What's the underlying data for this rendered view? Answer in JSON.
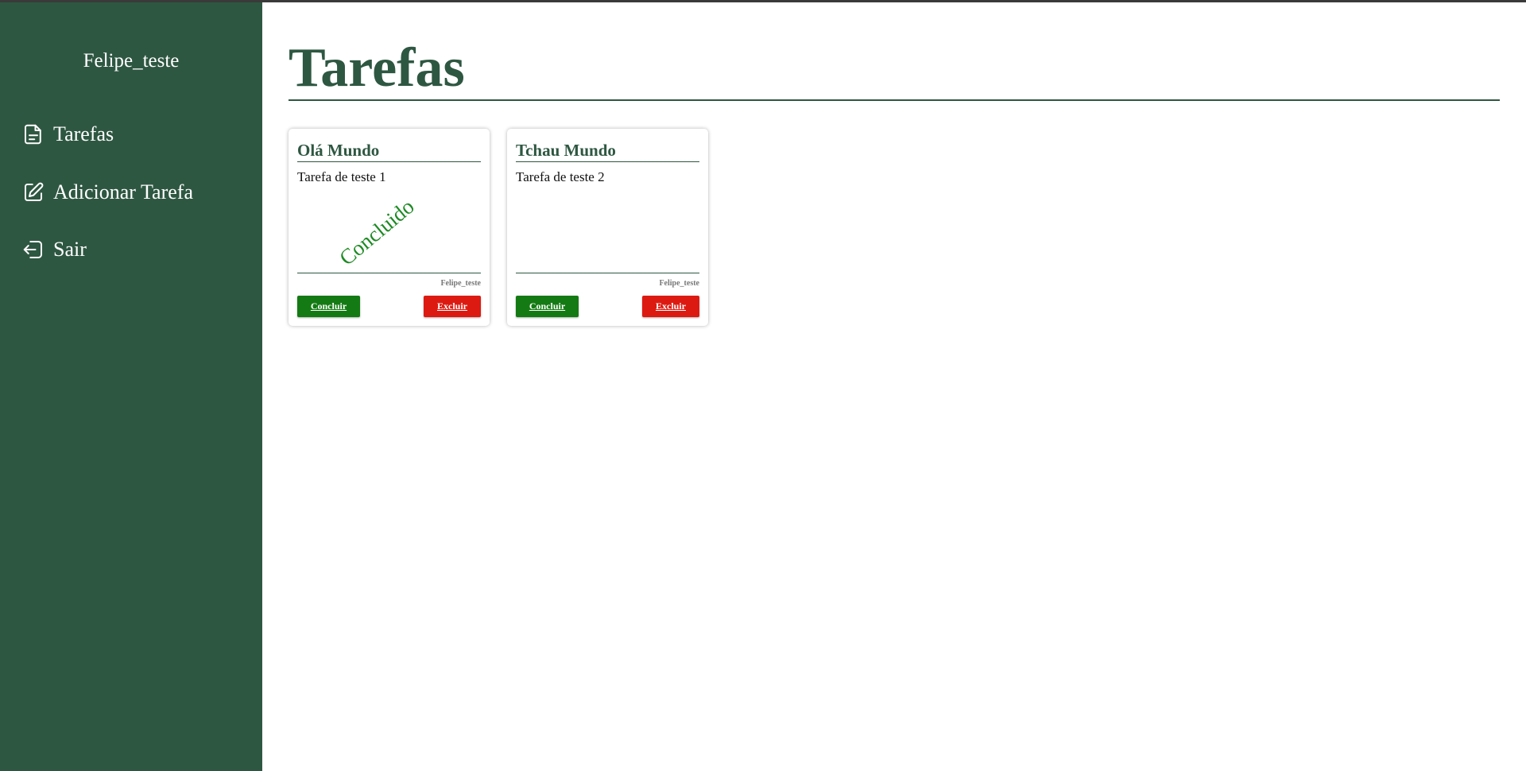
{
  "colors": {
    "sidebar_bg": "#2e5741",
    "title": "#2e5741",
    "concluir_button": "#147a13",
    "excluir_button": "#dd1a11",
    "concluido_stamp": "#1e8a24"
  },
  "sidebar": {
    "user_name": "Felipe_teste",
    "items": [
      {
        "label": "Tarefas",
        "icon": "document-icon"
      },
      {
        "label": "Adicionar Tarefa",
        "icon": "edit-icon"
      },
      {
        "label": "Sair",
        "icon": "logout-icon"
      }
    ]
  },
  "main": {
    "title": "Tarefas",
    "tasks": [
      {
        "title": "Olá Mundo",
        "description": "Tarefa de teste 1",
        "status_stamp": "Concluido",
        "author": "Felipe_teste",
        "complete_label": "Concluir",
        "delete_label": "Excluir"
      },
      {
        "title": "Tchau Mundo",
        "description": "Tarefa de teste 2",
        "status_stamp": "",
        "author": "Felipe_teste",
        "complete_label": "Concluir",
        "delete_label": "Excluir"
      }
    ]
  }
}
